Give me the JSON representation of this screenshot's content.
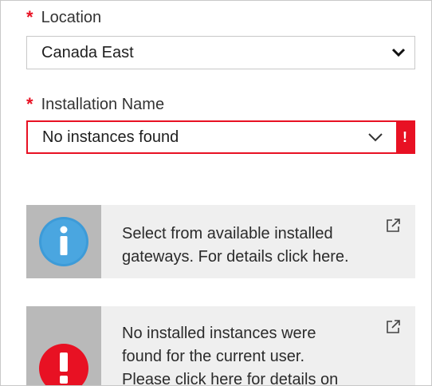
{
  "location": {
    "label": "Location",
    "required_mark": "*",
    "value": "Canada East"
  },
  "installation": {
    "label": "Installation Name",
    "required_mark": "*",
    "value": "No instances found",
    "error_mark": "!"
  },
  "cards": {
    "info": {
      "line1": "Select from available installed",
      "line2": "gateways. For details click here.",
      "icon": "info-icon"
    },
    "error": {
      "line1": "No installed instances were",
      "line2": "found for the current user.",
      "line3": "Please click here for details on",
      "icon": "error-icon",
      "glyph": "!"
    }
  },
  "colors": {
    "required": "#e81123",
    "info_icon": "#3d9bd8",
    "error_icon": "#e81123"
  }
}
